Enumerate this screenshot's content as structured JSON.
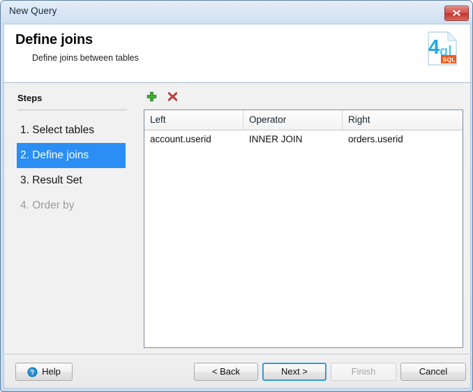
{
  "window": {
    "title": "New Query",
    "close_icon": "close-x-icon"
  },
  "header": {
    "title": "Define joins",
    "subtitle": "Define joins between tables",
    "logo": {
      "name": "4ql-sql-logo",
      "digit": "4",
      "word": "ql",
      "badge": "SQL",
      "accent_color": "#29b6e8",
      "badge_color": "#f0591e"
    }
  },
  "sidebar": {
    "heading": "Steps",
    "items": [
      {
        "label": "1. Select tables",
        "state": "normal"
      },
      {
        "label": "2. Define joins",
        "state": "current"
      },
      {
        "label": "3. Result Set",
        "state": "normal"
      },
      {
        "label": "4. Order by",
        "state": "disabled"
      }
    ],
    "highlight_color": "#2a8ef4"
  },
  "toolbar": {
    "add": {
      "name": "add-plus-icon",
      "tooltip": "Add",
      "color": "#2fa02f"
    },
    "remove": {
      "name": "delete-x-icon",
      "tooltip": "Remove",
      "color": "#d63b3b"
    }
  },
  "grid": {
    "columns": [
      "Left",
      "Operator",
      "Right"
    ],
    "rows": [
      [
        "account.userid",
        "INNER JOIN",
        "orders.userid"
      ]
    ]
  },
  "footer": {
    "help": {
      "label": "Help",
      "icon": "help-question-icon"
    },
    "back": {
      "label": "< Back",
      "disabled": false
    },
    "next": {
      "label": "Next >",
      "disabled": false,
      "default": true
    },
    "finish": {
      "label": "Finish",
      "disabled": true
    },
    "cancel": {
      "label": "Cancel",
      "disabled": false
    }
  }
}
